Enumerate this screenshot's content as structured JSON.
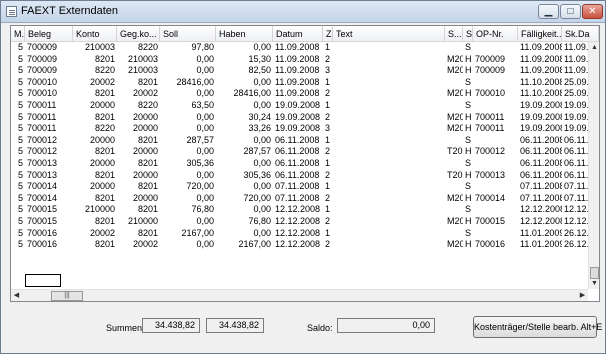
{
  "window": {
    "title": "FAEXT Externdaten"
  },
  "columns": [
    "M..",
    "Beleg",
    "Konto",
    "Geg.ko...",
    "Soll",
    "Haben",
    "Datum",
    "Z.",
    "Text",
    "S...",
    "S",
    "OP-Nr.",
    "Fälligkeit...",
    "Sk.Da"
  ],
  "rows": [
    [
      "5",
      "700009",
      "210003",
      "8220",
      "97,80",
      "0,00",
      "11.09.2008",
      "1",
      "",
      "",
      "S",
      "",
      "11.09.2008",
      "11.09.2"
    ],
    [
      "5",
      "700009",
      "8201",
      "210003",
      "0,00",
      "15,30",
      "11.09.2008",
      "2",
      "",
      "M20",
      "H",
      "700009",
      "11.09.2008",
      "11.09.2"
    ],
    [
      "5",
      "700009",
      "8220",
      "210003",
      "0,00",
      "82,50",
      "11.09.2008",
      "3",
      "",
      "M20",
      "H",
      "700009",
      "11.09.2008",
      "11.09.2"
    ],
    [
      "5",
      "700010",
      "20002",
      "8201",
      "28416,00",
      "0,00",
      "11.09.2008",
      "1",
      "",
      "",
      "S",
      "",
      "11.10.2008",
      "25.09.2"
    ],
    [
      "5",
      "700010",
      "8201",
      "20002",
      "0,00",
      "28416,00",
      "11.09.2008",
      "2",
      "",
      "M20",
      "H",
      "700010",
      "11.10.2008",
      "25.09.2"
    ],
    [
      "5",
      "700011",
      "20000",
      "8220",
      "63,50",
      "0,00",
      "19.09.2008",
      "1",
      "",
      "",
      "S",
      "",
      "19.09.2008",
      "19.09.2"
    ],
    [
      "5",
      "700011",
      "8201",
      "20000",
      "0,00",
      "30,24",
      "19.09.2008",
      "2",
      "",
      "M20",
      "H",
      "700011",
      "19.09.2008",
      "19.09.2"
    ],
    [
      "5",
      "700011",
      "8220",
      "20000",
      "0,00",
      "33,26",
      "19.09.2008",
      "3",
      "",
      "M20",
      "H",
      "700011",
      "19.09.2008",
      "19.09.2"
    ],
    [
      "5",
      "700012",
      "20000",
      "8201",
      "287,57",
      "0,00",
      "06.11.2008",
      "1",
      "",
      "",
      "S",
      "",
      "06.11.2008",
      "06.11.2"
    ],
    [
      "5",
      "700012",
      "8201",
      "20000",
      "0,00",
      "287,57",
      "06.11.2008",
      "2",
      "",
      "T20",
      "H",
      "700012",
      "06.11.2008",
      "06.11.2"
    ],
    [
      "5",
      "700013",
      "20000",
      "8201",
      "305,36",
      "0,00",
      "06.11.2008",
      "1",
      "",
      "",
      "S",
      "",
      "06.11.2008",
      "06.11.2"
    ],
    [
      "5",
      "700013",
      "8201",
      "20000",
      "0,00",
      "305,36",
      "06.11.2008",
      "2",
      "",
      "T20",
      "H",
      "700013",
      "06.11.2008",
      "06.11.2"
    ],
    [
      "5",
      "700014",
      "20000",
      "8201",
      "720,00",
      "0,00",
      "07.11.2008",
      "1",
      "",
      "",
      "S",
      "",
      "07.11.2008",
      "07.11.2"
    ],
    [
      "5",
      "700014",
      "8201",
      "20000",
      "0,00",
      "720,00",
      "07.11.2008",
      "2",
      "",
      "M20",
      "H",
      "700014",
      "07.11.2008",
      "07.11.2"
    ],
    [
      "5",
      "700015",
      "210000",
      "8201",
      "76,80",
      "0,00",
      "12.12.2008",
      "1",
      "",
      "",
      "S",
      "",
      "12.12.2008",
      "12.12.2"
    ],
    [
      "5",
      "700015",
      "8201",
      "210000",
      "0,00",
      "76,80",
      "12.12.2008",
      "2",
      "",
      "M20",
      "H",
      "700015",
      "12.12.2008",
      "12.12.2"
    ],
    [
      "5",
      "700016",
      "20002",
      "8201",
      "2167,00",
      "0,00",
      "12.12.2008",
      "1",
      "",
      "",
      "S",
      "",
      "11.01.2009",
      "26.12.2"
    ],
    [
      "5",
      "700016",
      "8201",
      "20002",
      "0,00",
      "2167,00",
      "12.12.2008",
      "2",
      "",
      "M20",
      "H",
      "700016",
      "11.01.2009",
      "26.12.2"
    ]
  ],
  "footer": {
    "summen_label": "Summen:",
    "soll_sum": "34.438,82",
    "haben_sum": "34.438,82",
    "saldo_label": "Saldo:",
    "saldo_value": "0,00",
    "button_label": "Kostenträger/Stelle bearb. Alt+E"
  }
}
